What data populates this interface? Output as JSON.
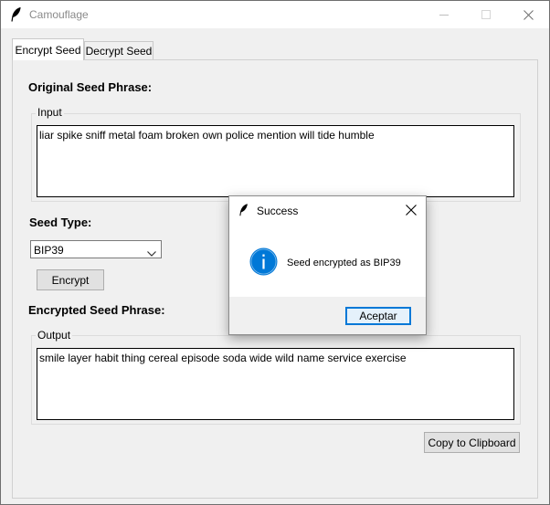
{
  "window": {
    "title": "Camouflage",
    "icons": {
      "app": "feather-icon",
      "minimize": "minimize-icon",
      "maximize": "maximize-icon",
      "close": "close-icon"
    }
  },
  "tabs": [
    {
      "label": "Encrypt Seed",
      "selected": true
    },
    {
      "label": "Decrypt Seed",
      "selected": false
    }
  ],
  "encrypt": {
    "original_heading": "Original Seed Phrase:",
    "input_group_label": "Input",
    "input_text": "liar spike sniff metal foam broken own police mention will tide humble",
    "seed_type_heading": "Seed Type:",
    "seed_type_value": "BIP39",
    "encrypt_button": "Encrypt",
    "encrypted_heading": "Encrypted Seed Phrase:",
    "output_group_label": "Output",
    "output_text": "smile layer habit thing cereal episode soda wide wild name service exercise",
    "copy_button": "Copy to Clipboard"
  },
  "dialog": {
    "title": "Success",
    "message": "Seed encrypted as BIP39",
    "ok_button": "Aceptar",
    "icons": {
      "app": "feather-icon",
      "close": "close-icon",
      "info": "info-icon"
    },
    "info_color": "#0078d7"
  },
  "colors": {
    "focus_blue": "#0078d7",
    "window_bg": "#f0f0f0"
  }
}
